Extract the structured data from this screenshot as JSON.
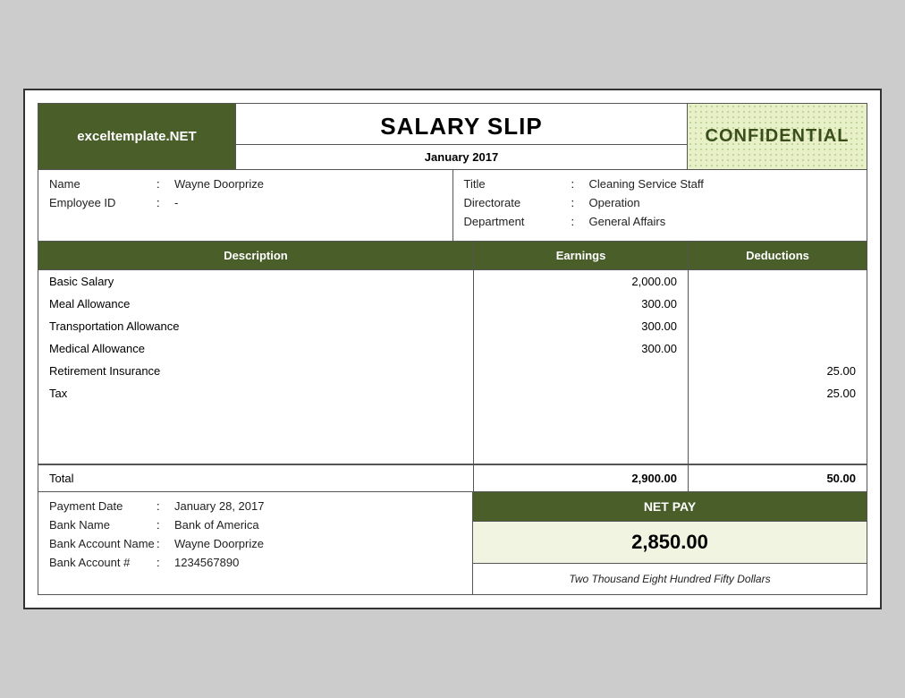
{
  "header": {
    "logo": "exceltemplate.NET",
    "title": "SALARY SLIP",
    "date": "January 2017",
    "confidential": "CONFIDENTIAL"
  },
  "employee": {
    "left": [
      {
        "label": "Name",
        "colon": ":",
        "value": "Wayne Doorprize"
      },
      {
        "label": "Employee ID",
        "colon": ":",
        "value": "-"
      }
    ],
    "right": [
      {
        "label": "Title",
        "colon": ":",
        "value": "Cleaning Service Staff"
      },
      {
        "label": "Directorate",
        "colon": ":",
        "value": "Operation"
      },
      {
        "label": "Department",
        "colon": ":",
        "value": "General Affairs"
      }
    ]
  },
  "table": {
    "headers": {
      "description": "Description",
      "earnings": "Earnings",
      "deductions": "Deductions"
    },
    "rows": [
      {
        "description": "Basic Salary",
        "earnings": "2,000.00",
        "deductions": ""
      },
      {
        "description": "Meal Allowance",
        "earnings": "300.00",
        "deductions": ""
      },
      {
        "description": "Transportation Allowance",
        "earnings": "300.00",
        "deductions": ""
      },
      {
        "description": "Medical Allowance",
        "earnings": "300.00",
        "deductions": ""
      },
      {
        "description": "Retirement Insurance",
        "earnings": "",
        "deductions": "25.00"
      },
      {
        "description": "Tax",
        "earnings": "",
        "deductions": "25.00"
      },
      {
        "description": "",
        "earnings": "",
        "deductions": ""
      },
      {
        "description": "",
        "earnings": "",
        "deductions": ""
      },
      {
        "description": "",
        "earnings": "",
        "deductions": ""
      }
    ],
    "total": {
      "label": "Total",
      "earnings": "2,900.00",
      "deductions": "50.00"
    }
  },
  "payment": {
    "rows": [
      {
        "label": "Payment Date",
        "colon": ":",
        "value": "January 28, 2017"
      },
      {
        "label": "Bank Name",
        "colon": ":",
        "value": "Bank of America"
      },
      {
        "label": "Bank Account Name",
        "colon": ":",
        "value": "Wayne Doorprize"
      },
      {
        "label": "Bank Account #",
        "colon": ":",
        "value": "1234567890"
      }
    ]
  },
  "netpay": {
    "header": "NET PAY",
    "amount": "2,850.00",
    "words": "Two Thousand Eight Hundred Fifty Dollars"
  }
}
